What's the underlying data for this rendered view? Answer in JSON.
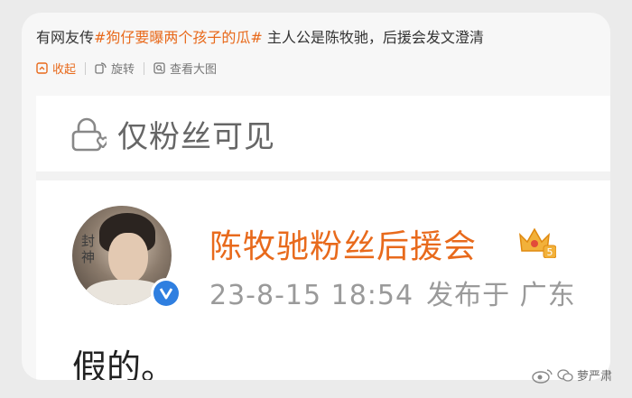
{
  "post": {
    "prefix": "有网友传",
    "topic": "#狗仔要曝两个孩子的瓜#",
    "suffix": " 主人公是陈牧驰，后援会发文澄清"
  },
  "toolbar": {
    "collapse": "收起",
    "rotate": "旋转",
    "view_large": "查看大图"
  },
  "screenshot": {
    "visibility": "仅粉丝可见",
    "account_name": "陈牧驰粉丝后援会",
    "crown_level": "5",
    "avatar_text": "封神",
    "post_time": "23-8-15 18:54",
    "post_location": "发布于 广东",
    "content": "假的。"
  },
  "watermark": {
    "text": "萝严肃"
  },
  "colors": {
    "accent": "#e86a1c",
    "verify": "#2f7fe0"
  }
}
